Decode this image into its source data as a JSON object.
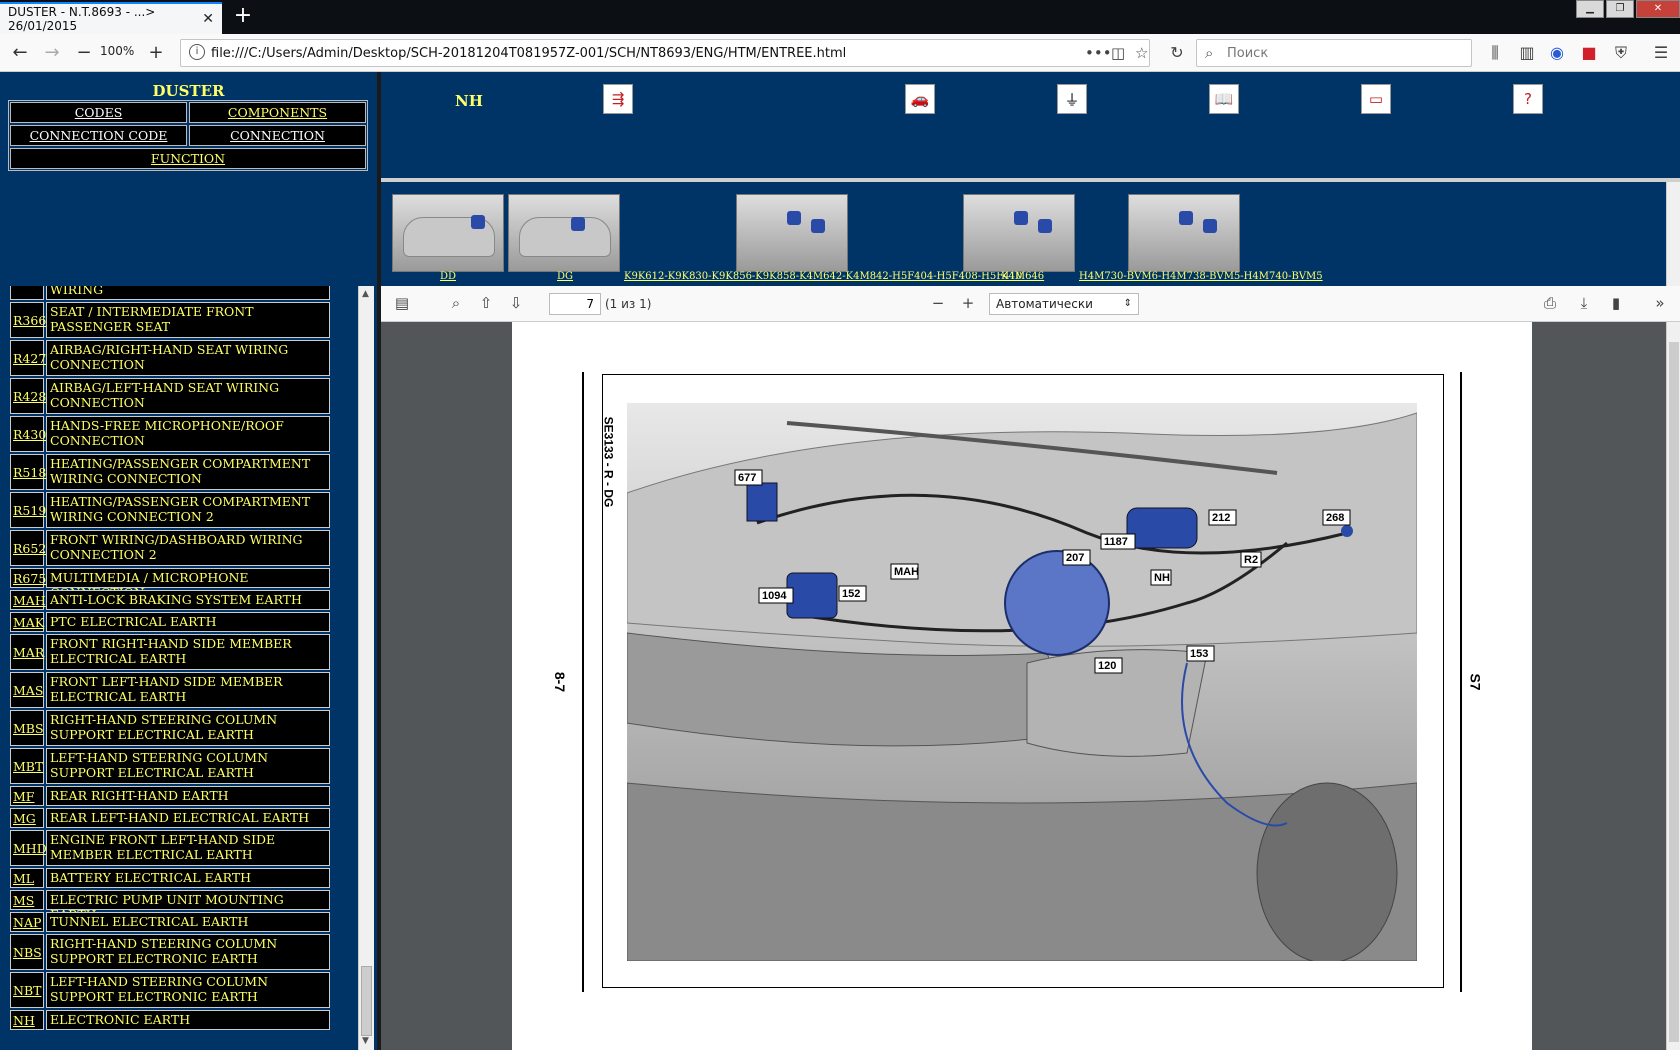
{
  "browser": {
    "tab_title": "DUSTER - N.T.8693 - ...> 26/01/2015",
    "zoom": "100%",
    "url": "file:///C:/Users/Admin/Desktop/SCH-20181204T081957Z-001/SCH/NT8693/ENG/HTM/ENTREE.html",
    "search_placeholder": "Поиск"
  },
  "header": {
    "title": "DUSTER",
    "menu": {
      "codes": "CODES",
      "components": "COMPONENTS",
      "connection_code": "CONNECTION CODE",
      "connection": "CONNECTION",
      "function": "FUNCTION"
    }
  },
  "toolbar": {
    "current": "NH"
  },
  "thumbnails": [
    {
      "label": "DD"
    },
    {
      "label": "DG"
    },
    {
      "label": "K9K612-K9K830-K9K856-K9K858-K4M642-K4M842-H5F404-H5F408-H5F410"
    },
    {
      "label": "K4M646"
    },
    {
      "label": "H4M730-BVM6-H4M738-BVM5-H4M740-BVM5"
    }
  ],
  "list": {
    "partial_top": "WIRING",
    "items": [
      {
        "code": "R366",
        "desc": "SEAT / INTERMEDIATE FRONT PASSENGER SEAT"
      },
      {
        "code": "R427",
        "desc": "AIRBAG/RIGHT-HAND SEAT WIRING CONNECTION"
      },
      {
        "code": "R428",
        "desc": "AIRBAG/LEFT-HAND SEAT WIRING CONNECTION"
      },
      {
        "code": "R430",
        "desc": "HANDS-FREE MICROPHONE/ROOF CONNECTION"
      },
      {
        "code": "R518",
        "desc": "HEATING/PASSENGER COMPARTMENT WIRING CONNECTION"
      },
      {
        "code": "R519",
        "desc": "HEATING/PASSENGER COMPARTMENT WIRING CONNECTION 2"
      },
      {
        "code": "R652",
        "desc": "FRONT WIRING/DASHBOARD WIRING CONNECTION 2"
      },
      {
        "code": "R675",
        "desc": "MULTIMEDIA / MICROPHONE CONNECTION"
      },
      {
        "code": "MAH",
        "desc": "ANTI-LOCK BRAKING SYSTEM EARTH"
      },
      {
        "code": "MAK",
        "desc": "PTC ELECTRICAL EARTH"
      },
      {
        "code": "MAR",
        "desc": "FRONT RIGHT-HAND SIDE MEMBER ELECTRICAL EARTH"
      },
      {
        "code": "MAS",
        "desc": "FRONT LEFT-HAND SIDE MEMBER ELECTRICAL EARTH"
      },
      {
        "code": "MBS",
        "desc": "RIGHT-HAND STEERING COLUMN SUPPORT ELECTRICAL EARTH"
      },
      {
        "code": "MBT",
        "desc": "LEFT-HAND STEERING COLUMN SUPPORT ELECTRICAL EARTH"
      },
      {
        "code": "MF",
        "desc": "REAR RIGHT-HAND EARTH"
      },
      {
        "code": "MG",
        "desc": "REAR LEFT-HAND ELECTRICAL EARTH"
      },
      {
        "code": "MHD",
        "desc": "ENGINE FRONT LEFT-HAND SIDE MEMBER ELECTRICAL EARTH"
      },
      {
        "code": "ML",
        "desc": "BATTERY ELECTRICAL EARTH"
      },
      {
        "code": "MS",
        "desc": "ELECTRIC PUMP UNIT MOUNTING EARTH"
      },
      {
        "code": "NAP",
        "desc": "TUNNEL ELECTRICAL EARTH"
      },
      {
        "code": "NBS",
        "desc": "RIGHT-HAND STEERING COLUMN SUPPORT ELECTRONIC EARTH"
      },
      {
        "code": "NBT",
        "desc": "LEFT-HAND STEERING COLUMN SUPPORT ELECTRONIC EARTH"
      },
      {
        "code": "NH",
        "desc": "ELECTRONIC EARTH"
      }
    ]
  },
  "pdf": {
    "page_number": "7",
    "page_count": "(1 из 1)",
    "zoom_option": "Автоматически"
  },
  "diagram": {
    "ref_code": "SE3133 - R - DG",
    "left_ref": "8-7",
    "right_ref": "S7",
    "labels": {
      "l677": "677",
      "l212": "212",
      "l268": "268",
      "l1187": "1187",
      "l207": "207",
      "lR2": "R2",
      "lNH": "NH",
      "lMAH": "MAH",
      "l1094": "1094",
      "l152": "152",
      "l120": "120",
      "l153": "153"
    }
  },
  "colors": {
    "frame": "#003366",
    "link": "#ffff66",
    "component": "#2a4aa8"
  }
}
